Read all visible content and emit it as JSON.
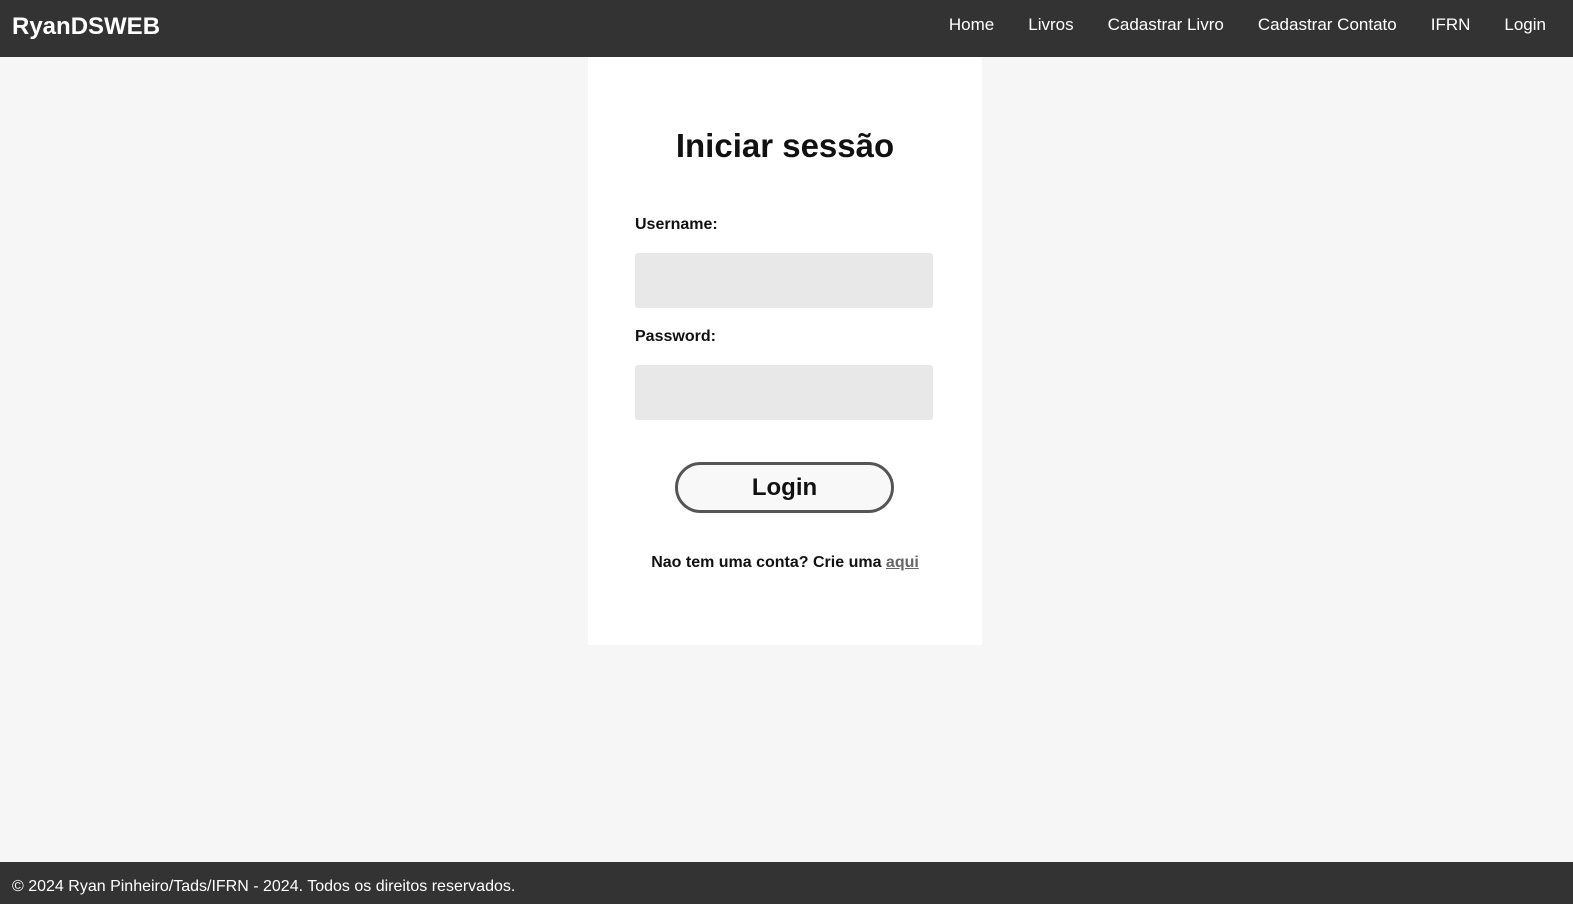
{
  "navbar": {
    "brand": "RyanDSWEB",
    "links": [
      {
        "label": "Home"
      },
      {
        "label": "Livros"
      },
      {
        "label": "Cadastrar Livro"
      },
      {
        "label": "Cadastrar Contato"
      },
      {
        "label": "IFRN"
      },
      {
        "label": "Login"
      }
    ]
  },
  "login": {
    "title": "Iniciar sessão",
    "username_label": "Username:",
    "username_value": "",
    "password_label": "Password:",
    "password_value": "",
    "submit_label": "Login",
    "signup_prefix": "Nao tem uma conta? Crie uma",
    "signup_link": "aqui"
  },
  "footer": {
    "text": "© 2024 Ryan Pinheiro/Tads/IFRN - 2024. Todos os direitos reservados."
  },
  "colors": {
    "navbar_bg": "#333333",
    "page_bg": "#f6f6f6",
    "card_bg": "#ffffff",
    "input_bg": "#e8e8e8",
    "button_border": "#555555",
    "link": "#666666"
  }
}
